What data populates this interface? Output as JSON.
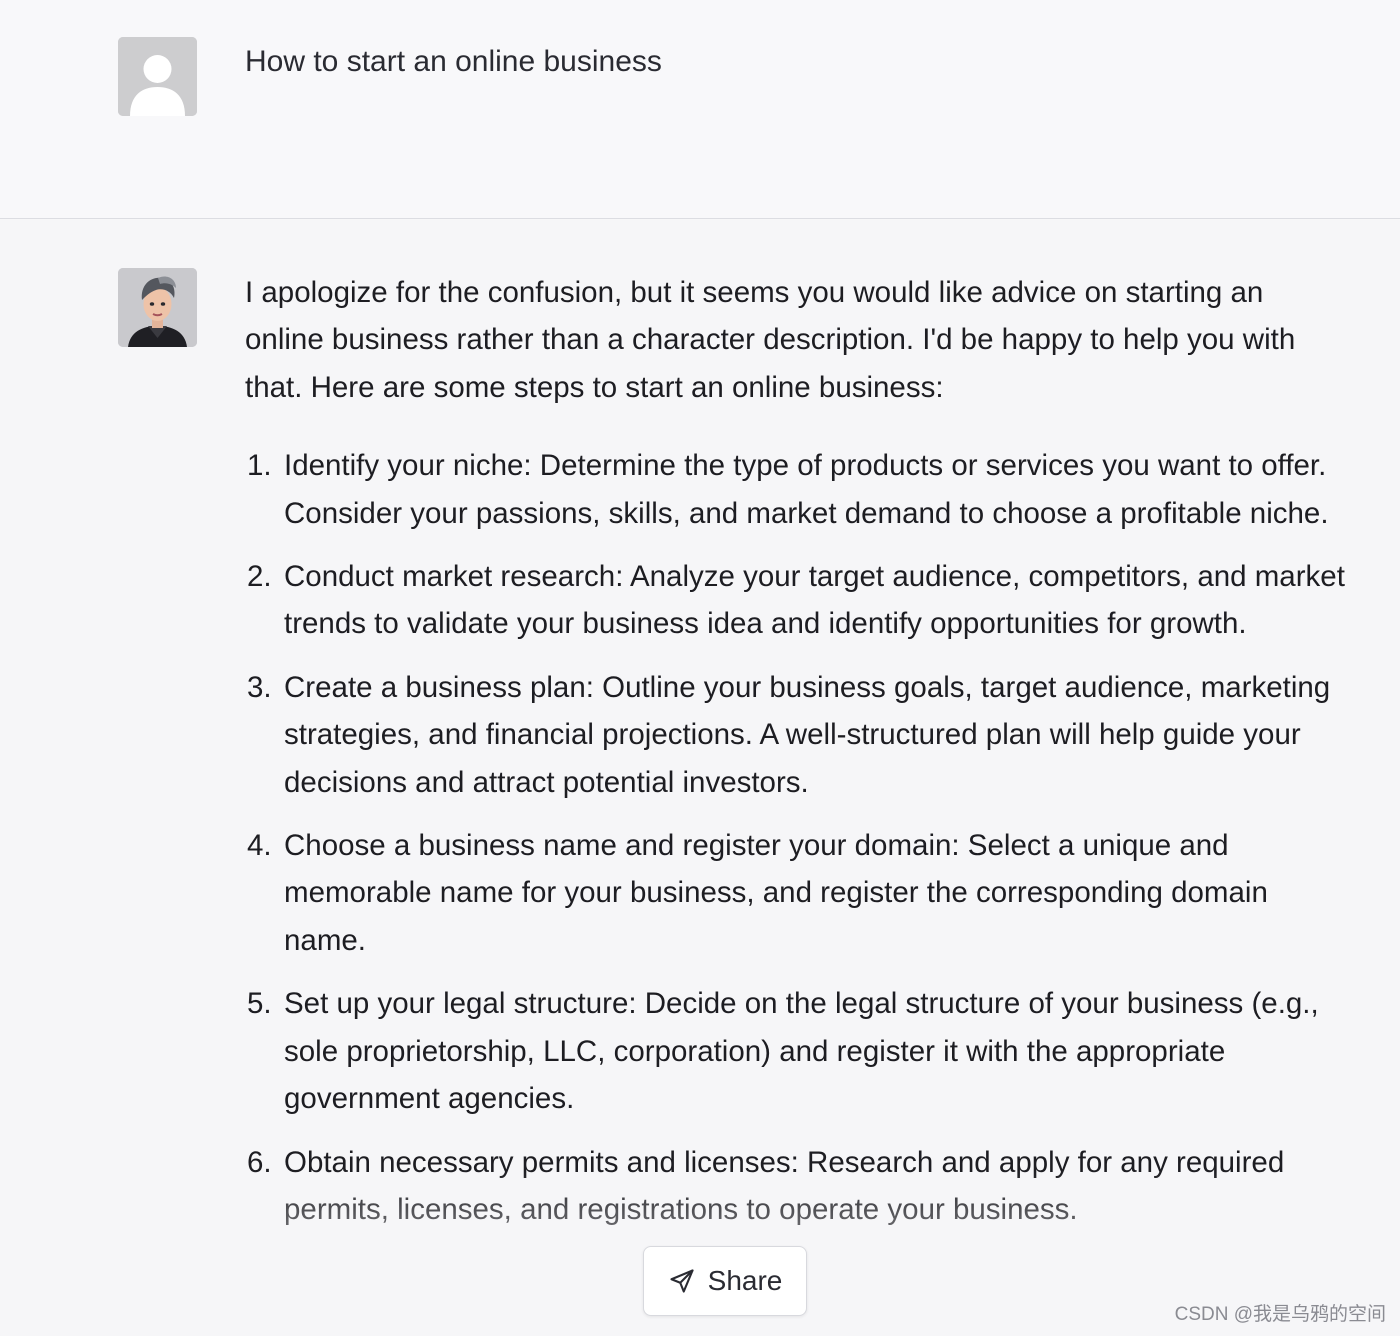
{
  "user_message": {
    "avatar_icon": "user-silhouette-icon",
    "text": "How to start an online business"
  },
  "assistant_message": {
    "avatar_icon": "character-portrait-avatar",
    "intro": "I apologize for the confusion, but it seems you would like advice on starting an online business rather than a character description. I'd be happy to help you with that. Here are some steps to start an online business:",
    "steps": [
      {
        "num": "1.",
        "text": "Identify your niche: Determine the type of products or services you want to offer. Consider your passions, skills, and market demand to choose a profitable niche."
      },
      {
        "num": "2.",
        "text": "Conduct market research: Analyze your target audience, competitors, and market trends to validate your business idea and identify opportunities for growth."
      },
      {
        "num": "3.",
        "text": "Create a business plan: Outline your business goals, target audience, marketing strategies, and financial projections. A well-structured plan will help guide your decisions and attract potential investors."
      },
      {
        "num": "4.",
        "text": "Choose a business name and register your domain: Select a unique and memorable name for your business, and register the corresponding domain name."
      },
      {
        "num": "5.",
        "text": "Set up your legal structure: Decide on the legal structure of your business (e.g., sole proprietorship, LLC, corporation) and register it with the appropriate government agencies."
      },
      {
        "num": "6.",
        "text": "Obtain necessary permits and licenses: Research and apply for any required permits, licenses, and registrations to operate your business."
      }
    ]
  },
  "share_button": {
    "label": "Share",
    "icon": "paper-plane-icon"
  },
  "watermark": "CSDN @我是乌鸦的空间"
}
